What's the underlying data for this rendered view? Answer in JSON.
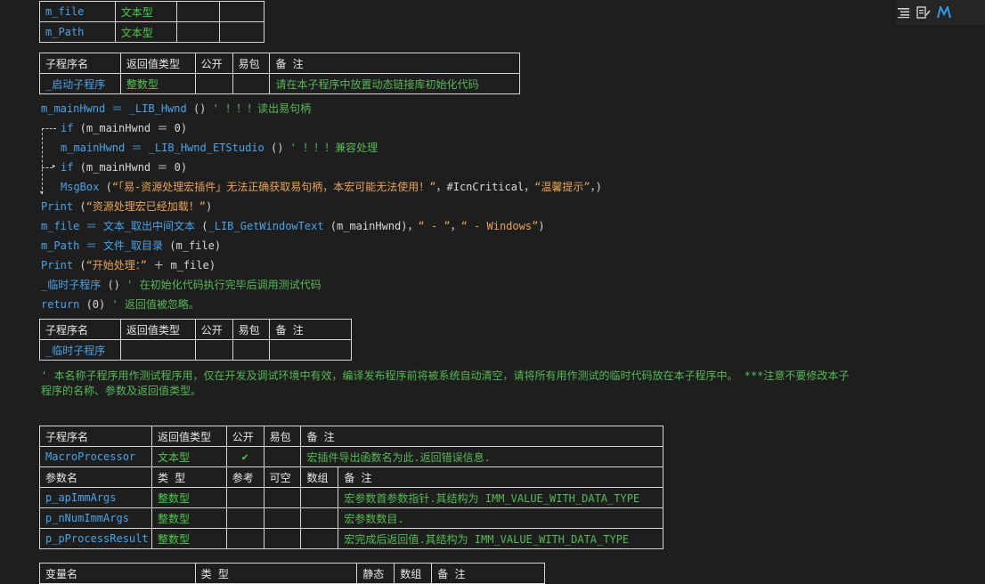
{
  "toolbar": {
    "icons": [
      "format-icon",
      "code-icon",
      "logo-icon"
    ]
  },
  "var_table_top": {
    "rows": [
      {
        "name": "m_file",
        "type": "文本型"
      },
      {
        "name": "m_Path",
        "type": "文本型"
      }
    ]
  },
  "sub1": {
    "headers": [
      "子程序名",
      "返回值类型",
      "公开",
      "易包",
      "备 注"
    ],
    "name": "_启动子程序",
    "return_type": "整数型",
    "note": "请在本子程序中放置动态链接库初始化代码"
  },
  "code": {
    "l1_a": "m_mainHwnd ＝ ",
    "l1_b": "_LIB_Hwnd",
    "l1_c": " () ",
    "l1_d": "' ！！！读出易句柄",
    "l2_a": "if",
    "l2_b": " (m_mainHwnd ＝ 0)",
    "l3_a": "m_mainHwnd ＝ ",
    "l3_b": "_LIB_Hwnd_ETStudio",
    "l3_c": " () ",
    "l3_d": "' ！！！兼容处理",
    "l4_a": "if",
    "l4_b": " (m_mainHwnd ＝ 0)",
    "l5_a": "MsgBox",
    "l5_b": " (",
    "l5_c": "“「易-资源处理宏插件」无法正确获取易句柄，本宏可能无法使用！”",
    "l5_d": "，#IcnCritical，",
    "l5_e": "“温馨提示”",
    "l5_f": "，)",
    "l6_a": "Print",
    "l6_b": " (",
    "l6_c": "“资源处理宏已经加载！”",
    "l6_d": ")",
    "l7_a": "m_file ＝ ",
    "l7_b": "文本_取出中间文本",
    "l7_c": " (",
    "l7_d": "_LIB_GetWindowText",
    "l7_e": " (m_mainHwnd)，",
    "l7_f": "“ - ”",
    "l7_g": "，",
    "l7_h": "“ - Windows”",
    "l7_i": ")",
    "l8_a": "m_Path ＝ ",
    "l8_b": "文件_取目录",
    "l8_c": " (m_file)",
    "l9_a": "Print",
    "l9_b": " (",
    "l9_c": "“开始处理：”",
    "l9_d": " ＋ m_file)",
    "l10_a": "_临时子程序",
    "l10_b": " () ",
    "l10_c": "' 在初始化代码执行完毕后调用测试代码",
    "l11_a": "return",
    "l11_b": " (0) ",
    "l11_c": "' 返回值被忽略。"
  },
  "sub2": {
    "headers": [
      "子程序名",
      "返回值类型",
      "公开",
      "易包",
      "备 注"
    ],
    "name": "_临时子程序"
  },
  "comment_block": {
    "line1": "' 本名称子程序用作测试程序用，仅在开发及调试环境中有效，编译发布程序前将被系统自动清空，请将所有用作测试的临时代码放在本子程序中。 ***注意不要修改本子",
    "line2": "程序的名称、参数及返回值类型。"
  },
  "sub3": {
    "headers": [
      "子程序名",
      "返回值类型",
      "公开",
      "易包",
      "备 注"
    ],
    "name": "MacroProcessor",
    "return_type": "文本型",
    "public_check": "✔",
    "note": "宏插件导出函数名为此.返回错误信息.",
    "param_headers": [
      "参数名",
      "类 型",
      "参考",
      "可空",
      "数组",
      "备 注"
    ],
    "params": [
      {
        "name": "p_apImmArgs",
        "type": "整数型",
        "note": "宏参数首参数指针.其结构为 IMM_VALUE_WITH_DATA_TYPE"
      },
      {
        "name": "p_nNumImmArgs",
        "type": "整数型",
        "note": "宏参数数目."
      },
      {
        "name": "p_pProcessResult",
        "type": "整数型",
        "note": "宏完成后返回值.其结构为 IMM_VALUE_WITH_DATA_TYPE"
      }
    ],
    "var_headers": [
      "变量名",
      "类 型",
      "静态",
      "数组",
      "备 注"
    ]
  }
}
